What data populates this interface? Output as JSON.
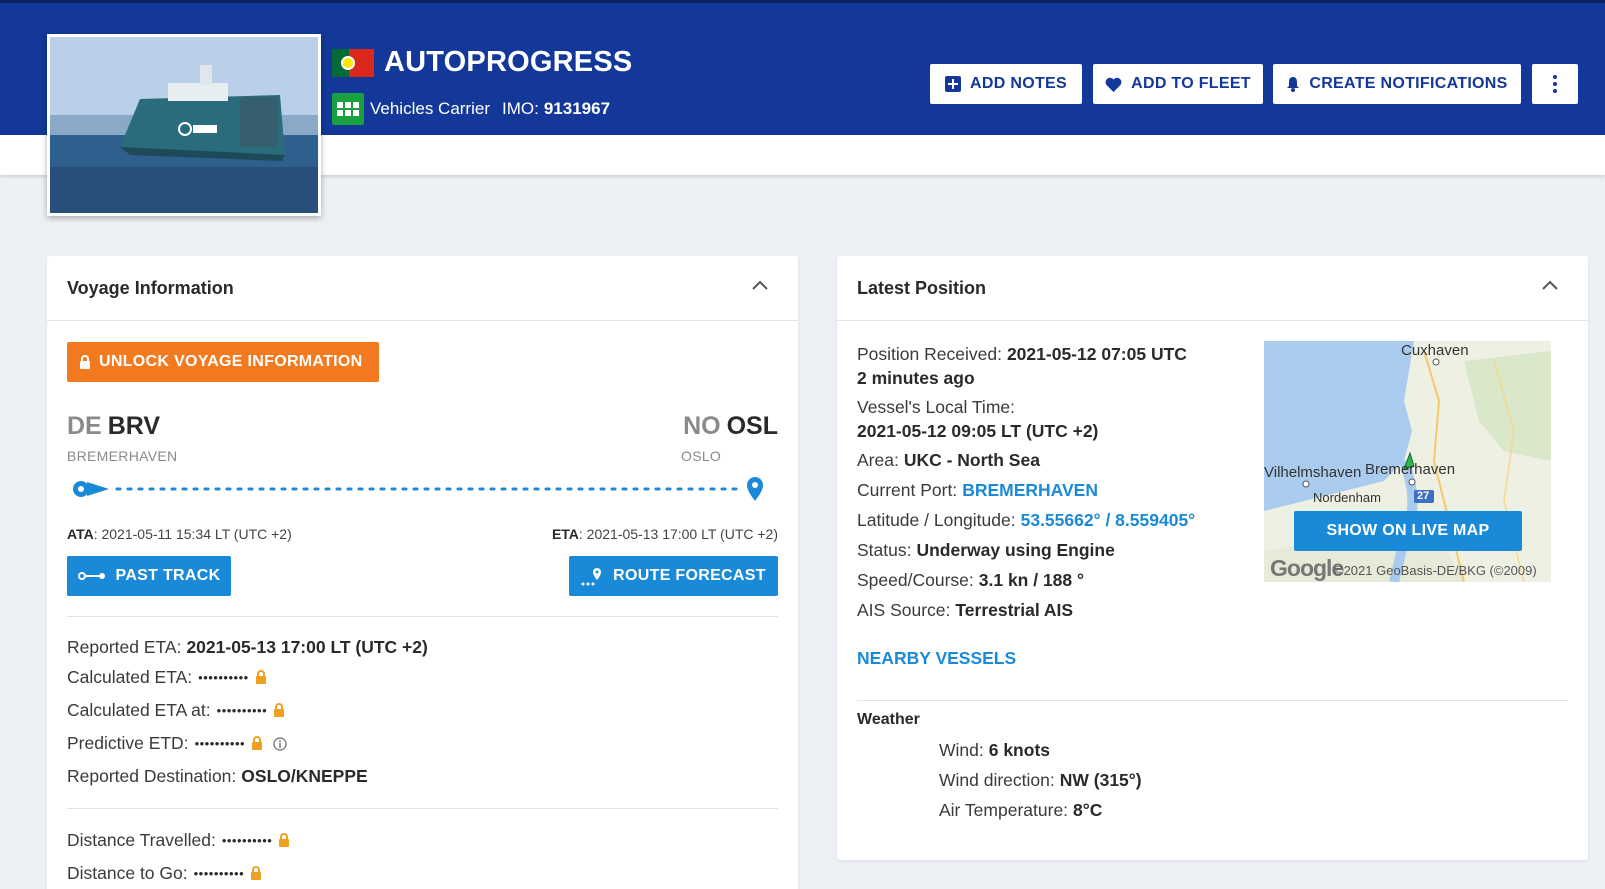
{
  "header": {
    "vessel_name": "AUTOPROGRESS",
    "vessel_type": "Vehicles Carrier",
    "imo_label": "IMO:",
    "imo": "9131967",
    "flag_icon": "portugal-flag-icon",
    "buttons": {
      "add_notes": "ADD NOTES",
      "add_to_fleet": "ADD TO FLEET",
      "create_notifications": "CREATE NOTIFICATIONS"
    }
  },
  "voyage": {
    "title": "Voyage Information",
    "unlock_label": "UNLOCK VOYAGE INFORMATION",
    "departure": {
      "country": "DE",
      "code": "BRV",
      "name": "BREMERHAVEN"
    },
    "arrival": {
      "country": "NO",
      "code": "OSL",
      "name": "OSLO"
    },
    "ata_label": "ATA",
    "ata_value": ": 2021-05-11 15:34 LT (UTC +2)",
    "eta_label": "ETA",
    "eta_value": ": 2021-05-13 17:00 LT (UTC +2)",
    "past_track_label": "PAST TRACK",
    "route_forecast_label": "ROUTE FORECAST",
    "reported_eta_label": "Reported ETA:",
    "reported_eta": "2021-05-13 17:00 LT (UTC +2)",
    "calculated_eta_label": "Calculated ETA:",
    "calculated_eta_at_label": "Calculated ETA at:",
    "predictive_etd_label": "Predictive ETD:",
    "reported_destination_label": "Reported Destination:",
    "reported_destination": "OSLO/KNEPPE",
    "distance_travelled_label": "Distance Travelled:",
    "distance_to_go_label": "Distance to Go:",
    "masked": "••••••••••"
  },
  "position": {
    "title": "Latest Position",
    "received_label": "Position Received:",
    "received": "2021-05-12 07:05 UTC",
    "received_ago": "2 minutes ago",
    "local_time_label": "Vessel's Local Time:",
    "local_time": "2021-05-12 09:05 LT (UTC +2)",
    "area_label": "Area:",
    "area": "UKC - North Sea",
    "port_label": "Current Port:",
    "port": "BREMERHAVEN",
    "latlon_label": "Latitude / Longitude:",
    "latlon": "53.55662° / 8.559405°",
    "status_label": "Status:",
    "status": "Underway using Engine",
    "speed_label": "Speed/Course:",
    "speed": "3.1 kn / 188 °",
    "ais_label": "AIS Source:",
    "ais": "Terrestrial AIS",
    "nearby_label": "NEARBY VESSELS",
    "map": {
      "show_label": "SHOW ON LIVE MAP",
      "place_cuxhaven": "Cuxhaven",
      "place_wilhelmshaven": "Vilhelmshaven",
      "place_bremerhaven": "Bremerhaven",
      "place_nordenham": "Nordenham",
      "road_number": "27",
      "google": "Google",
      "copyright": "©2021 GeoBasis-DE/BKG (©2009)"
    },
    "weather": {
      "title": "Weather",
      "wind_label": "Wind:",
      "wind": "6 knots",
      "wind_dir_label": "Wind direction:",
      "wind_dir": "NW (315°)",
      "air_temp_label": "Air Temperature:",
      "air_temp": "8°C"
    }
  },
  "colors": {
    "header_bg": "#13389a",
    "accent_blue": "#1a8ad8",
    "unlock_orange": "#f47a1f",
    "lock_orange": "#f0a020"
  }
}
